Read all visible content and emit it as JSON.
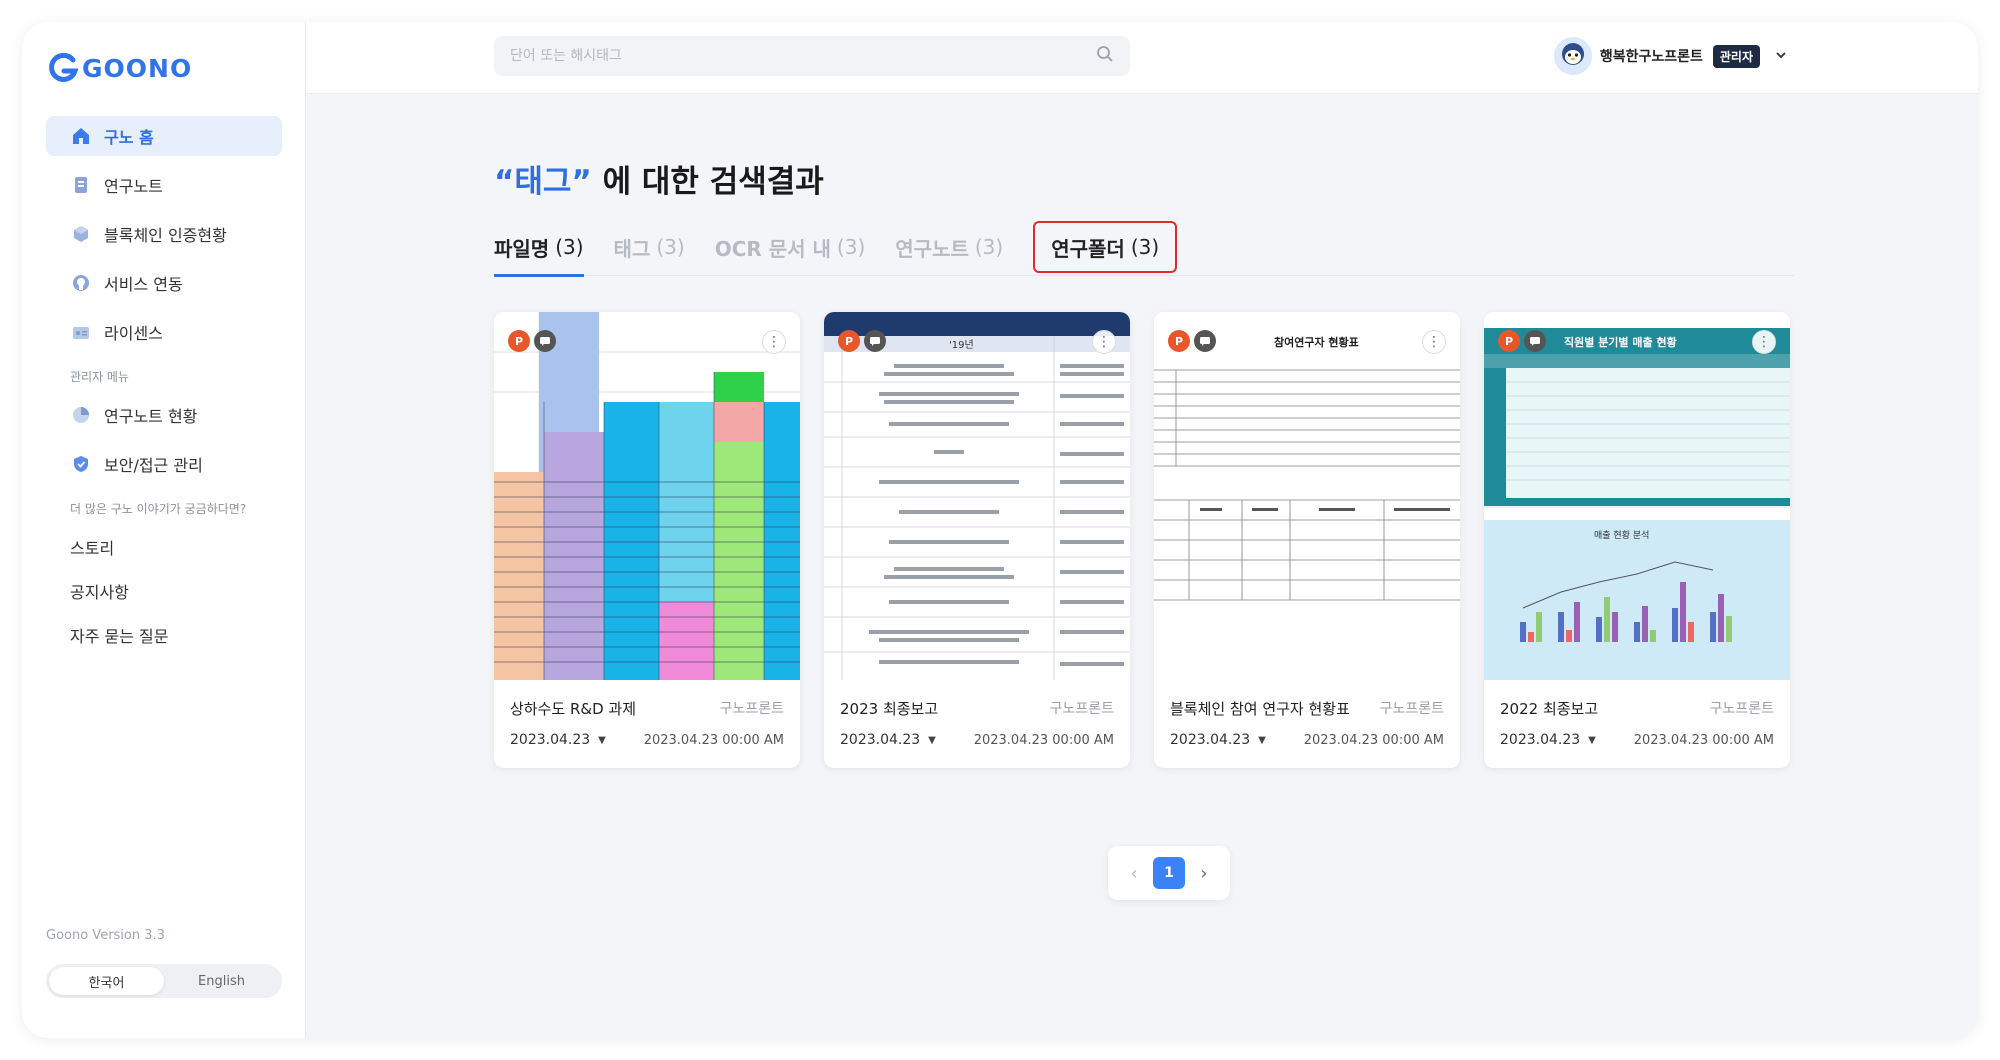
{
  "app": {
    "logo_text": "GOONO"
  },
  "sidebar": {
    "items": [
      {
        "label": "구노 홈",
        "icon": "home-icon",
        "active": true
      },
      {
        "label": "연구노트",
        "icon": "note-icon"
      },
      {
        "label": "블록체인 인증현황",
        "icon": "blockchain-icon"
      },
      {
        "label": "서비스 연동",
        "icon": "github-icon"
      },
      {
        "label": "라이센스",
        "icon": "license-icon"
      }
    ],
    "admin_label": "관리자 메뉴",
    "admin_items": [
      {
        "label": "연구노트 현황",
        "icon": "pie-chart-icon"
      },
      {
        "label": "보안/접근 관리",
        "icon": "shield-icon"
      }
    ],
    "more_label": "더 많은 구노 이야기가 궁금하다면?",
    "more_items": [
      "스토리",
      "공지사항",
      "자주 묻는 질문"
    ],
    "version": "Goono Version 3.3",
    "languages": [
      "한국어",
      "English"
    ],
    "active_language": "한국어"
  },
  "header": {
    "search_placeholder": "단어 또는 해시태그",
    "user_name": "행복한구노프론트",
    "role_badge": "관리자"
  },
  "main": {
    "title_keyword": "“태그”",
    "title_rest": " 에 대한 검색결과",
    "tabs": [
      {
        "label": "파일명",
        "count": "(3)"
      },
      {
        "label": "태그",
        "count": "(3)"
      },
      {
        "label": "OCR 문서 내",
        "count": "(3)"
      },
      {
        "label": "연구노트",
        "count": "(3)"
      },
      {
        "label": "연구폴더",
        "count": "(3)"
      }
    ],
    "cards": [
      {
        "name": "상하수도 R&D 과제",
        "owner": "구노프론트",
        "date": "2023.04.23",
        "timestamp": "2023.04.23 00:00 AM"
      },
      {
        "name": "2023 최종보고",
        "owner": "구노프론트",
        "date": "2023.04.23",
        "timestamp": "2023.04.23 00:00 AM",
        "thumb_header": "'19년"
      },
      {
        "name": "블록체인 참여 연구자 현황표",
        "owner": "구노프론트",
        "date": "2023.04.23",
        "timestamp": "2023.04.23 00:00 AM",
        "thumb_header": "참여연구자 현황표"
      },
      {
        "name": "2022 최종보고",
        "owner": "구노프론트",
        "date": "2023.04.23",
        "timestamp": "2023.04.23 00:00 AM",
        "thumb_header": "직원별 분기별 매출 현황",
        "thumb_sub": "매출 현황 분석"
      }
    ],
    "pagination": {
      "current": "1"
    }
  },
  "colors": {
    "accent": "#2f6fe0",
    "highlight_border": "#e12b2b",
    "badge": "#1e2a44"
  }
}
